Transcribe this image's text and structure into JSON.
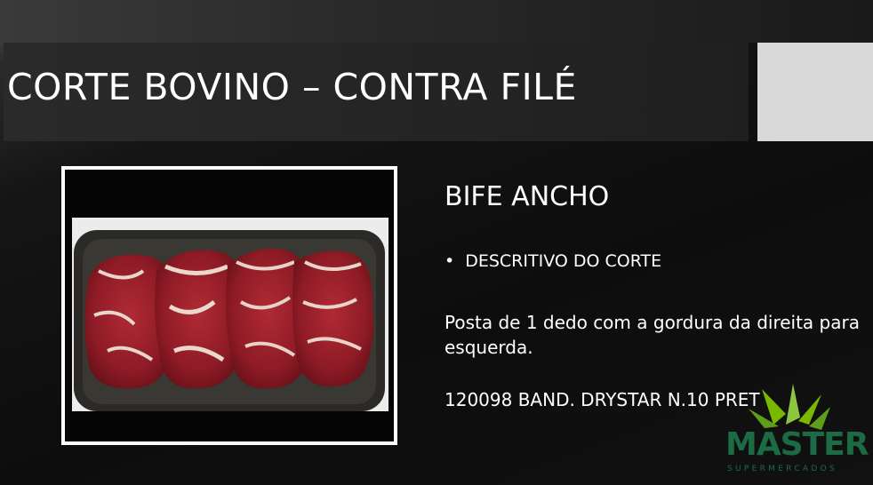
{
  "slide": {
    "title": "CORTE BOVINO – CONTRA FILÉ",
    "subtitle": "BIFE ANCHO",
    "bullet": "DESCRITIVO DO CORTE",
    "description": "Posta de 1 dedo com a gordura da direita para esquerda.",
    "product_code": "120098 BAND. DRYSTAR N.10 PRET"
  },
  "photo": {
    "icon": "meat-tray-photo"
  },
  "logo": {
    "name": "MASTER",
    "tagline": "SUPERMERCADOS",
    "color": "#1d6b45",
    "accent": "#7ab800"
  },
  "colors": {
    "background": "#0d0d0d",
    "title_bar": "#242424",
    "placeholder_box": "#d9d9d9",
    "text": "#ffffff"
  }
}
